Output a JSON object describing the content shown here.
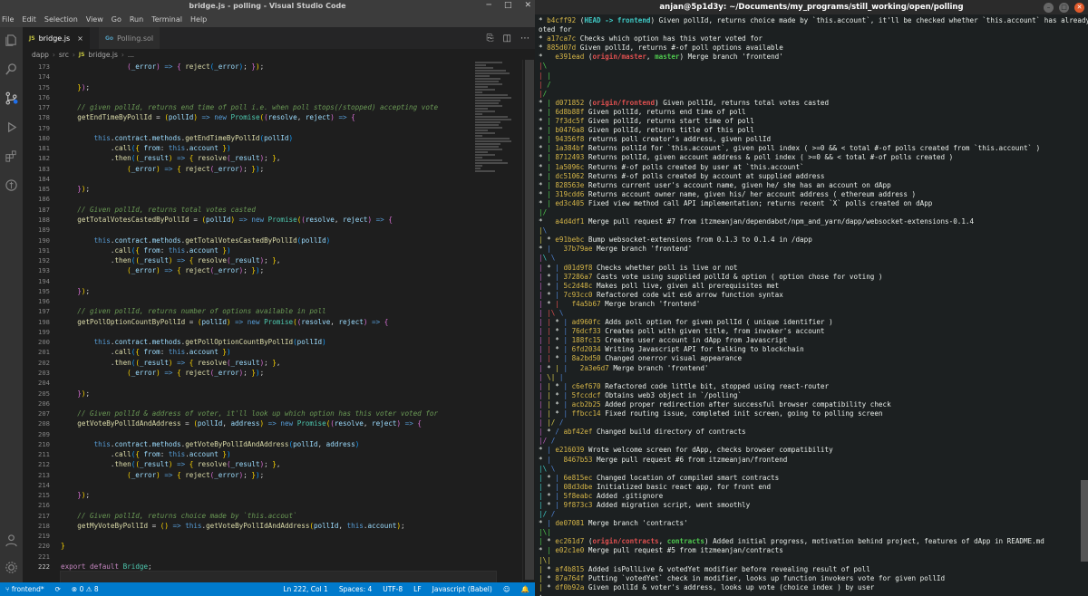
{
  "vscode": {
    "title": "bridge.js - polling - Visual Studio Code",
    "menu": [
      "File",
      "Edit",
      "Selection",
      "View",
      "Go",
      "Run",
      "Terminal",
      "Help"
    ],
    "tabs": [
      {
        "icon": "JS",
        "label": "bridge.js",
        "close": "×"
      },
      {
        "icon": "Go",
        "label": "Polling.sol"
      }
    ],
    "breadcrumb": [
      "dapp",
      "src",
      "JS",
      "bridge.js",
      "..."
    ],
    "line_numbers": [
      "173",
      "174",
      "175",
      "176",
      "177",
      "178",
      "179",
      "180",
      "181",
      "182",
      "183",
      "184",
      "185",
      "186",
      "187",
      "188",
      "189",
      "190",
      "191",
      "192",
      "193",
      "194",
      "195",
      "196",
      "197",
      "198",
      "199",
      "200",
      "201",
      "202",
      "203",
      "204",
      "205",
      "206",
      "207",
      "208",
      "209",
      "210",
      "211",
      "212",
      "213",
      "214",
      "215",
      "216",
      "217",
      "218",
      "219",
      "220",
      "221",
      "222"
    ],
    "status": {
      "branch": "frontend*",
      "errors": "0",
      "warnings": "8",
      "position": "Ln 222, Col 1",
      "spaces": "Spaces: 4",
      "encoding": "UTF-8",
      "eol": "LF",
      "language": "Javascript (Babel)"
    }
  },
  "terminal": {
    "title": "anjan@5p1d3y: ~/Documents/my_programs/still_working/open/polling"
  },
  "colors": {
    "status_bar": "#007acc",
    "editor_bg": "#1e1e1e",
    "terminal_bg": "#1c2021"
  }
}
